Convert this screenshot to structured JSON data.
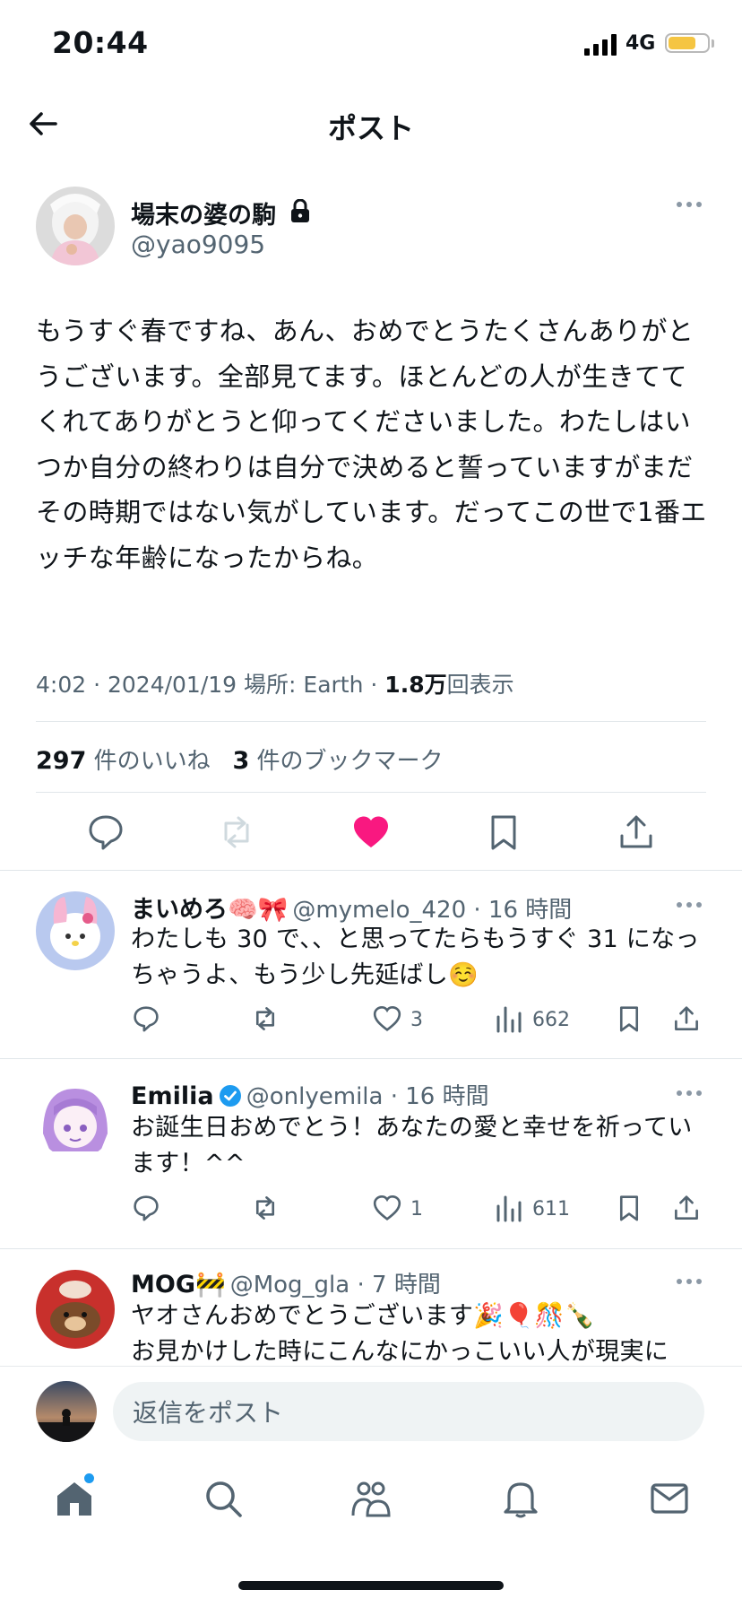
{
  "status_bar": {
    "time": "20:44",
    "network": "4G",
    "battery_level": 0.72
  },
  "header": {
    "title": "ポスト"
  },
  "post": {
    "author_name": "場末の婆の駒",
    "author_handle": "@yao9095",
    "text": "もうすぐ春ですね、あん、おめでとうたくさんありがとうございます。全部見てます。ほとんどの人が生きててくれてありがとうと仰ってくださいました。わたしはいつか自分の終わりは自分で決めると誓っていますがまだその時期ではない気がしています。だってこの世で1番エッチな年齢になったからね。",
    "time": "4:02",
    "date": "2024/01/19",
    "location": "場所: Earth",
    "views_count": "1.8万",
    "views_label": "回表示",
    "likes_count": "297",
    "likes_label": "件のいいね",
    "bookmarks_count": "3",
    "bookmarks_label": "件のブックマーク"
  },
  "replies": [
    {
      "name": "まいめろ🧠🎀",
      "handle": "@mymelo_420",
      "time": "16 時間",
      "text": "わたしも 30 で、、と思ってたらもうすぐ 31 になっちゃうよ、もう少し先延ばし☺️",
      "likes": "3",
      "views": "662"
    },
    {
      "name": "Emilia",
      "handle": "@onlyemila",
      "time": "16 時間",
      "text": "お誕生日おめでとう！あなたの愛と幸せを祈っています！^^",
      "likes": "1",
      "views": "611"
    },
    {
      "name": "MOG🚧",
      "handle": "@Mog_gla",
      "time": "7 時間",
      "text_line1": "ヤオさんおめでとうございます🎉🎈🎊🍾",
      "text_line2": "お見かけした時にこんなにかっこいい人が現実に"
    }
  ],
  "compose": {
    "placeholder": "返信をポスト"
  },
  "colors": {
    "like_pink": "#f91880",
    "verified_blue": "#1d9bf0",
    "muted": "#536471"
  },
  "icons": [
    "back-arrow-icon",
    "lock-icon",
    "more-icon",
    "reply-icon",
    "repost-icon",
    "like-icon",
    "bookmark-icon",
    "share-icon",
    "views-icon",
    "verified-icon",
    "home-icon",
    "search-icon",
    "communities-icon",
    "notifications-icon",
    "messages-icon"
  ]
}
